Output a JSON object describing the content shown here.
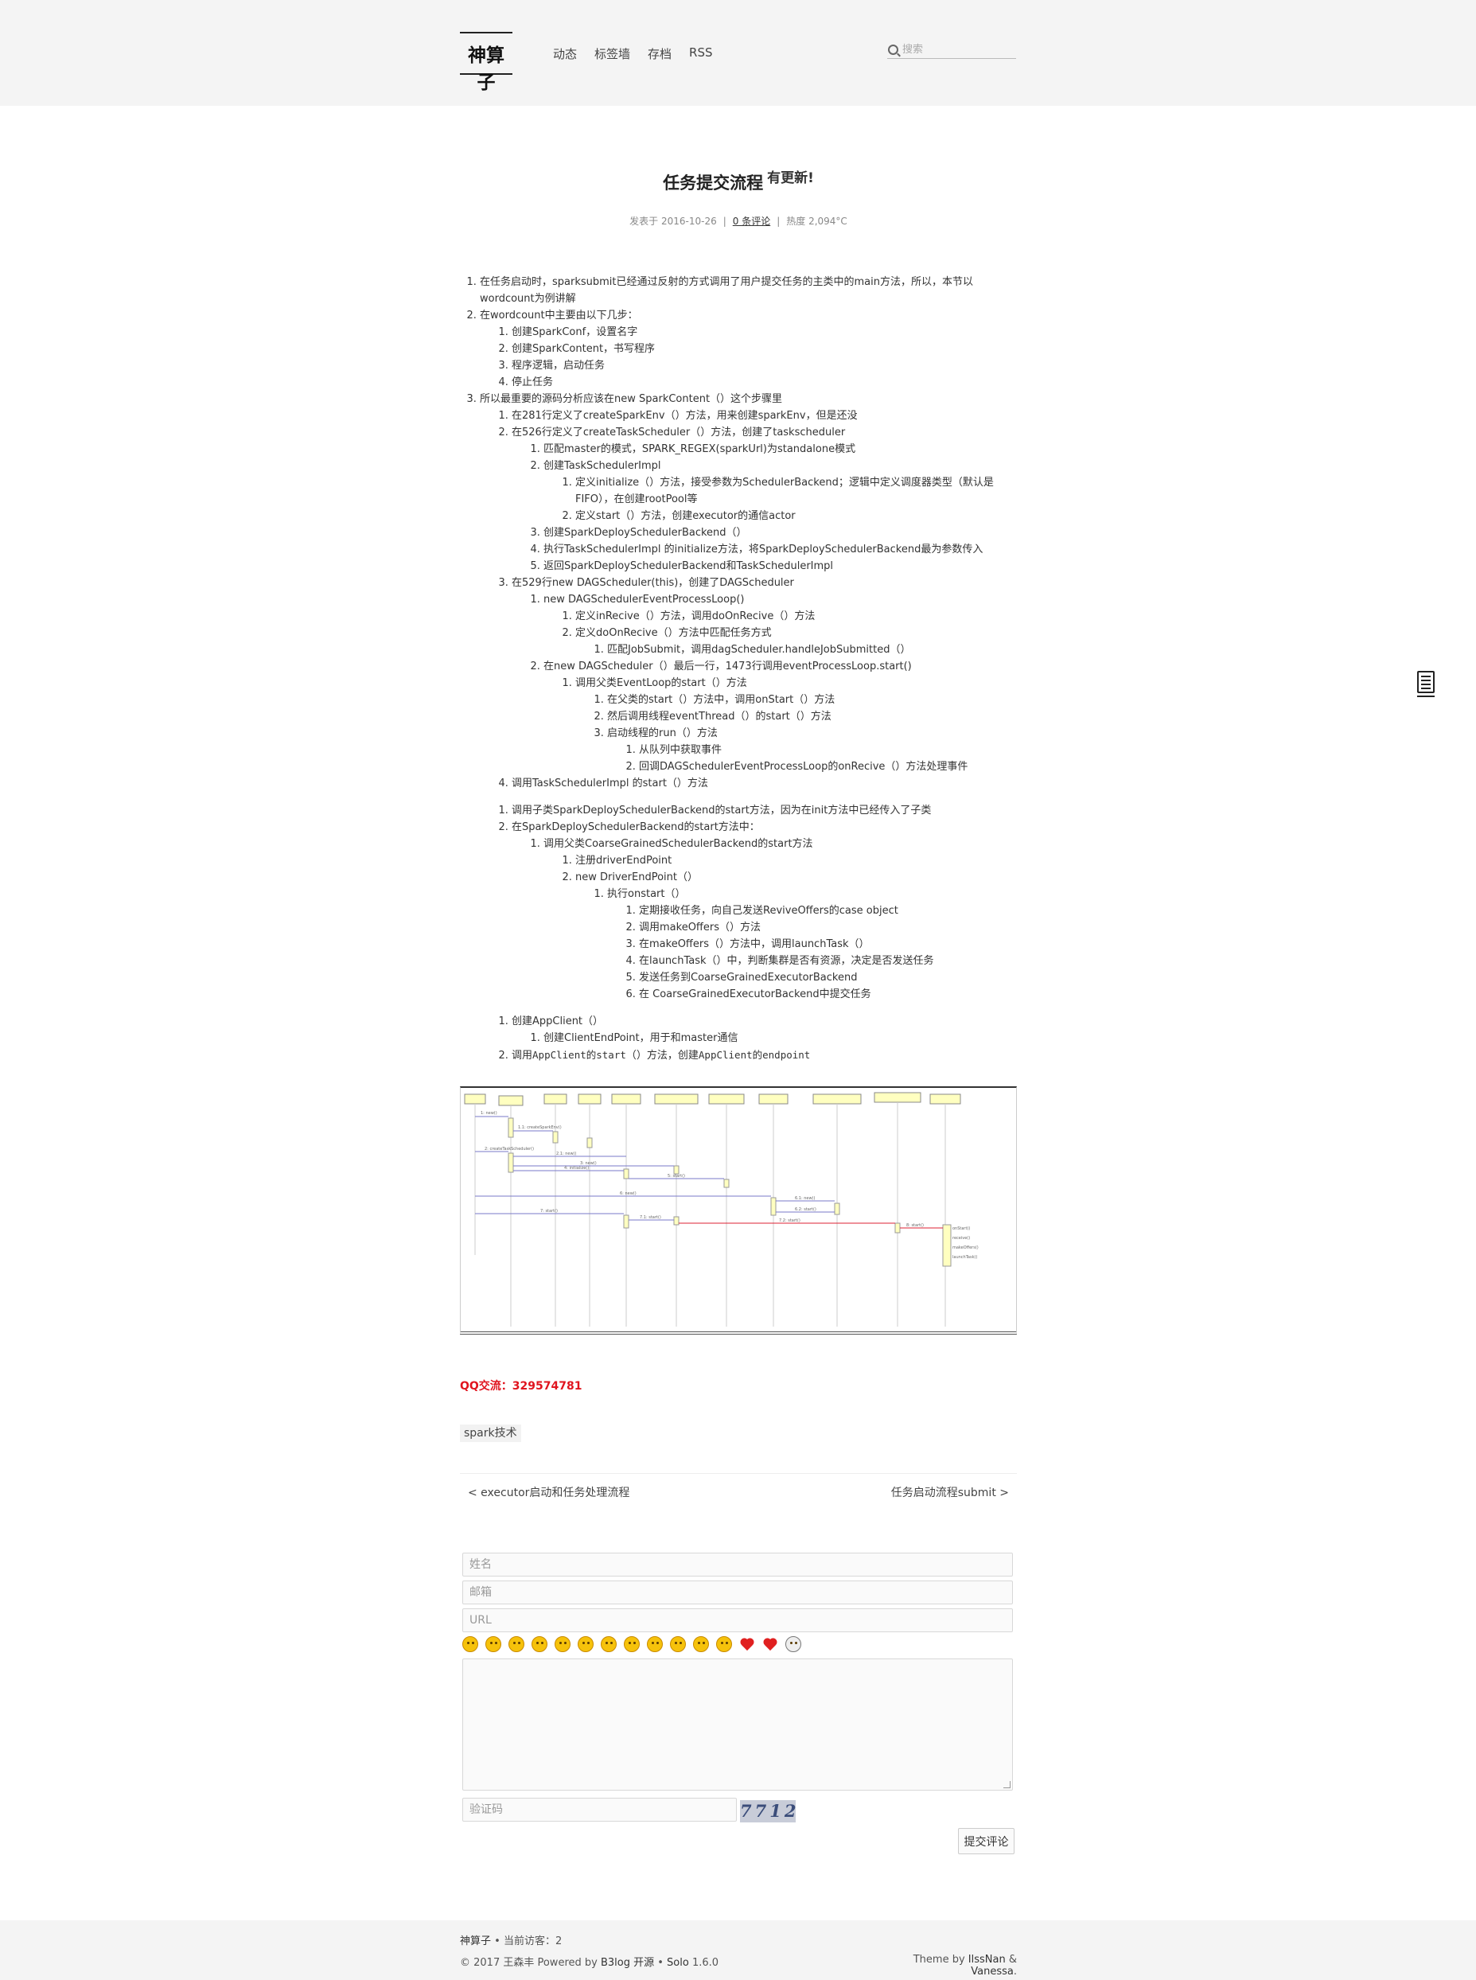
{
  "header": {
    "logo": "神算子",
    "nav": [
      "动态",
      "标签墙",
      "存档",
      "RSS"
    ],
    "search_placeholder": "搜索"
  },
  "article": {
    "title": "任务提交流程",
    "title_suffix": "有更新!",
    "meta_published": "发表于 2016-10-26",
    "meta_comments": "0 条评论",
    "meta_heat": "热度 2,094°C",
    "intro": {
      "item1": "在任务启动时，sparksubmit已经通过反射的方式调用了用户提交任务的主类中的main方法，所以，本节以wordcount为例讲解",
      "item2": "在wordcount中主要由以下几步：",
      "item2_sub": [
        "创建SparkConf，设置名字",
        "创建SparkContent，书写程序",
        "程序逻辑，启动任务",
        "停止任务"
      ],
      "item3": "所以最重要的源码分析应该在new SparkContent（）这个步骤里",
      "s1": "在281行定义了createSparkEnv（）方法，用来创建sparkEnv，但是还没",
      "s2": "在526行定义了createTaskScheduler（）方法，创建了taskscheduler",
      "s2a": "匹配master的模式，SPARK_REGEX(sparkUrl)为standalone模式",
      "s2b": "创建TaskSchedulerImpl",
      "s2b1": "定义initialize（）方法，接受参数为SchedulerBackend；逻辑中定义调度器类型（默认是FIFO），在创建rootPool等",
      "s2b2": "定义start（）方法，创建executor的通信actor",
      "s2c": "创建SparkDeploySchedulerBackend（）",
      "s2d": "执行TaskSchedulerImpl 的initialize方法，将SparkDeploySchedulerBackend最为参数传入",
      "s2e": "返回SparkDeploySchedulerBackend和TaskSchedulerImpl",
      "s3": "在529行new DAGScheduler(this)，创建了DAGScheduler",
      "s3a": "new DAGSchedulerEventProcessLoop()",
      "s3a1": "定义inRecive（）方法，调用doOnRecive（）方法",
      "s3a2": "定义doOnRecive（）方法中匹配任务方式",
      "s3a2a": "匹配JobSubmit，调用dagScheduler.handleJobSubmitted（）",
      "s3b": "在new DAGScheduler（）最后一行，1473行调用eventProcessLoop.start()",
      "s3b1": "调用父类EventLoop的start（）方法",
      "s3b1a": "在父类的start（）方法中，调用onStart（）方法",
      "s3b1b": "然后调用线程eventThread（）的start（）方法",
      "s3b1c": "启动线程的run（）方法",
      "s3b1c1": "从队列中获取事件",
      "s3b1c2": "回调DAGSchedulerEventProcessLoop的onRecive（）方法处理事件",
      "s4": "调用TaskSchedulerImpl 的start（）方法"
    },
    "section2": {
      "i1": "调用子类SparkDeploySchedulerBackend的start方法，因为在init方法中已经传入了子类",
      "i2": "在SparkDeploySchedulerBackend的start方法中：",
      "i2a": "调用父类CoarseGrainedSchedulerBackend的start方法",
      "i2a1": "注册driverEndPoint",
      "i2a2": "new DriverEndPoint（）",
      "i2a2a": "执行onstart（）",
      "steps": [
        "定期接收任务，向自己发送ReviveOffers的case object",
        "调用makeOffers（）方法",
        "在makeOffers（）方法中，调用launchTask（）",
        "在launchTask（）中，判断集群是否有资源，决定是否发送任务",
        "发送任务到CoarseGrainedExecutorBackend",
        "在 CoarseGrainedExecutorBackend中提交任务"
      ]
    },
    "section3": {
      "i1": "创建AppClient（）",
      "i1a": "创建ClientEndPoint，用于和master通信",
      "i2_a": "调用",
      "i2_code1": "AppClient的start",
      "i2_b": "（）方法，创建",
      "i2_code2": "AppClient的endpoint"
    },
    "qq": "QQ交流：329574781",
    "tag": "spark技术"
  },
  "pager": {
    "prev": "< executor启动和任务处理流程",
    "next": "任务启动流程submit >"
  },
  "comment_form": {
    "name_placeholder": "姓名",
    "email_placeholder": "邮箱",
    "url_placeholder": "URL",
    "captcha_placeholder": "验证码",
    "captcha_text": "7712",
    "submit_label": "提交评论",
    "emojis": [
      "smile-emoji",
      "laugh-emoji",
      "grin-emoji",
      "frown-emoji",
      "shock-emoji",
      "tongue-emoji",
      "blush-emoji",
      "sweat-emoji",
      "wink-emoji",
      "surprise-emoji",
      "cool-emoji",
      "kiss-emoji",
      "heart-emoji",
      "broken-heart-emoji",
      "skull-emoji"
    ]
  },
  "footer": {
    "site_link": "神算子",
    "visitors": " • 当前访客：2",
    "copyright": "© 2017 王森丰 Powered by ",
    "b3log": "B3log 开源",
    "bullet": " • ",
    "solo": "Solo",
    "version": " 1.6.0",
    "theme_prefix": "Theme by ",
    "theme_author": "IlssNan",
    "theme_amp": " & ",
    "theme_name": "Vanessa",
    "theme_dot": "."
  }
}
